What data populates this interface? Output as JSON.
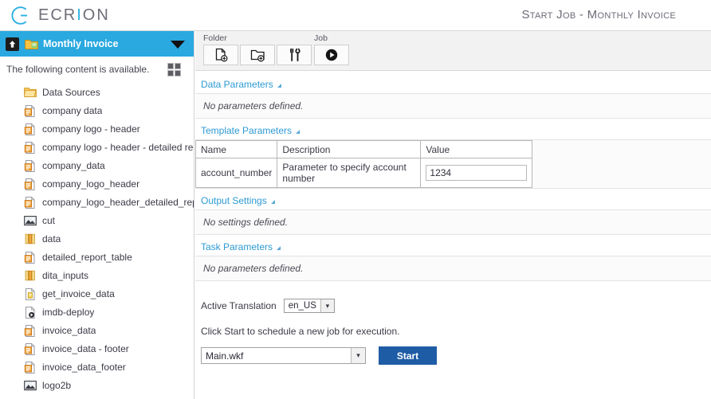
{
  "brand": {
    "name_part1": "ECR",
    "name_hl": "I",
    "name_part2": "ON",
    "logo_icon": "ecrion-circle-logo",
    "accent_color": "#2bb0e3"
  },
  "header": {
    "page_title": "Start Job - Monthly Invoice"
  },
  "sidebar": {
    "header": {
      "up_icon": "arrow-up-icon",
      "folder_icon": "folder-open-icon",
      "title": "Monthly Invoice",
      "caret_icon": "chevron-down-icon",
      "background_color": "#29a9e0"
    },
    "subheader": {
      "text": "The following content is available.",
      "view_icon": "grid-view-icon"
    },
    "items": [
      {
        "label": "Data Sources",
        "icon": "folder-icon"
      },
      {
        "label": "company data",
        "icon": "xml-document-icon"
      },
      {
        "label": "company logo - header",
        "icon": "xml-document-icon"
      },
      {
        "label": "company logo - header - detailed rep···",
        "icon": "xml-document-icon"
      },
      {
        "label": "company_data",
        "icon": "xml-document-icon"
      },
      {
        "label": "company_logo_header",
        "icon": "xml-document-icon"
      },
      {
        "label": "company_logo_header_detailed_report",
        "icon": "xml-document-icon"
      },
      {
        "label": "cut",
        "icon": "image-icon"
      },
      {
        "label": "data",
        "icon": "data-columns-icon"
      },
      {
        "label": "detailed_report_table",
        "icon": "xml-document-icon"
      },
      {
        "label": "dita_inputs",
        "icon": "data-columns-icon"
      },
      {
        "label": "get_invoice_data",
        "icon": "script-document-icon"
      },
      {
        "label": "imdb-deploy",
        "icon": "deploy-document-icon"
      },
      {
        "label": "invoice_data",
        "icon": "xml-document-icon"
      },
      {
        "label": "invoice_data - footer",
        "icon": "xml-document-icon"
      },
      {
        "label": "invoice_data_footer",
        "icon": "xml-document-icon"
      },
      {
        "label": "logo2b",
        "icon": "image-icon"
      }
    ]
  },
  "toolbar": {
    "groups": [
      {
        "label": "Folder"
      },
      {
        "label": "Job"
      }
    ],
    "buttons": [
      {
        "name": "new-file-button",
        "icon": "new-file-icon"
      },
      {
        "name": "new-folder-button",
        "icon": "new-folder-icon"
      },
      {
        "name": "tools-button",
        "icon": "tools-icon"
      },
      {
        "name": "run-job-button",
        "icon": "play-icon"
      }
    ]
  },
  "sections": {
    "data_parameters": {
      "title": "Data Parameters",
      "empty_text": "No parameters defined."
    },
    "template_parameters": {
      "title": "Template Parameters",
      "columns": [
        "Name",
        "Description",
        "Value"
      ],
      "rows": [
        {
          "name": "account_number",
          "description": "Parameter to specify account number",
          "value": "1234"
        }
      ]
    },
    "output_settings": {
      "title": "Output Settings",
      "empty_text": "No settings defined."
    },
    "task_parameters": {
      "title": "Task Parameters",
      "empty_text": "No parameters defined."
    }
  },
  "footer": {
    "translation_label": "Active Translation",
    "translation_value": "en_US",
    "hint": "Click Start to schedule a new job for execution.",
    "workflow_value": "Main.wkf",
    "start_label": "Start",
    "start_color": "#1f5ca6"
  }
}
